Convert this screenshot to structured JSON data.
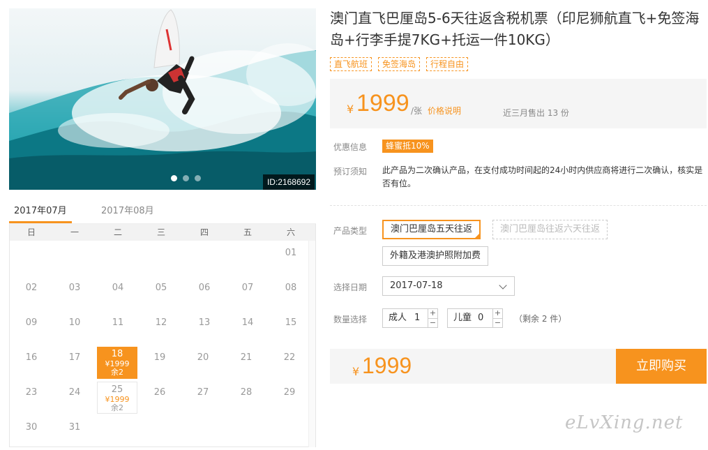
{
  "hero": {
    "id_label": "ID:2168692",
    "dots": 3,
    "active_dot": 0
  },
  "calendar": {
    "tabs": [
      "2017年07月",
      "2017年08月"
    ],
    "active_tab": 0,
    "weekdays": [
      "日",
      "一",
      "二",
      "三",
      "四",
      "五",
      "六"
    ],
    "weeks": [
      [
        {
          "d": ""
        },
        {
          "d": ""
        },
        {
          "d": ""
        },
        {
          "d": ""
        },
        {
          "d": ""
        },
        {
          "d": ""
        },
        {
          "d": "01"
        }
      ],
      [
        {
          "d": "02"
        },
        {
          "d": "03"
        },
        {
          "d": "04"
        },
        {
          "d": "05"
        },
        {
          "d": "06"
        },
        {
          "d": "07"
        },
        {
          "d": "08"
        }
      ],
      [
        {
          "d": "09"
        },
        {
          "d": "10"
        },
        {
          "d": "11"
        },
        {
          "d": "12"
        },
        {
          "d": "13"
        },
        {
          "d": "14"
        },
        {
          "d": "15"
        }
      ],
      [
        {
          "d": "16"
        },
        {
          "d": "17"
        },
        {
          "d": "18",
          "price": "¥1999",
          "remain": "余2",
          "state": "selected"
        },
        {
          "d": "19"
        },
        {
          "d": "20"
        },
        {
          "d": "21"
        },
        {
          "d": "22"
        }
      ],
      [
        {
          "d": "23"
        },
        {
          "d": "24"
        },
        {
          "d": "25",
          "price": "¥1999",
          "remain": "余2",
          "state": "available"
        },
        {
          "d": "26"
        },
        {
          "d": "27"
        },
        {
          "d": "28"
        },
        {
          "d": "29"
        }
      ],
      [
        {
          "d": "30"
        },
        {
          "d": "31"
        },
        {
          "d": ""
        },
        {
          "d": ""
        },
        {
          "d": ""
        },
        {
          "d": ""
        },
        {
          "d": ""
        }
      ]
    ]
  },
  "product": {
    "title": "澳门直飞巴厘岛5-6天往返含税机票（印尼狮航直飞+免签海岛+行李手提7KG+托运一件10KG）",
    "tags": [
      "直飞航班",
      "免签海岛",
      "行程自由"
    ]
  },
  "price_box": {
    "currency": "¥",
    "price": "1999",
    "unit": "/张",
    "price_note": "价格说明",
    "sold": "近三月售出 13 份"
  },
  "promo": {
    "label": "优惠信息",
    "badge": "蜂蜜抵10%"
  },
  "notice": {
    "label": "预订须知",
    "text": "此产品为二次确认产品，在支付成功时间起的24小时内供应商将进行二次确认，核实是否有位。"
  },
  "product_type": {
    "label": "产品类型",
    "options": [
      "澳门巴厘岛五天往返",
      "澳门巴厘岛往返六天往返",
      "外籍及港澳护照附加费"
    ]
  },
  "date_select": {
    "label": "选择日期",
    "value": "2017-07-18"
  },
  "quantity": {
    "label": "数量选择",
    "adult_label": "成人",
    "adult_value": "1",
    "child_label": "儿童",
    "child_value": "0",
    "plus": "+",
    "minus": "−",
    "remain": "（剩余 2 件）"
  },
  "buy_bar": {
    "currency": "¥",
    "price": "1999",
    "button": "立即购买"
  },
  "watermark": "eLvXing.net",
  "colors": {
    "accent": "#f7931e",
    "panel": "#f5f5f5"
  }
}
